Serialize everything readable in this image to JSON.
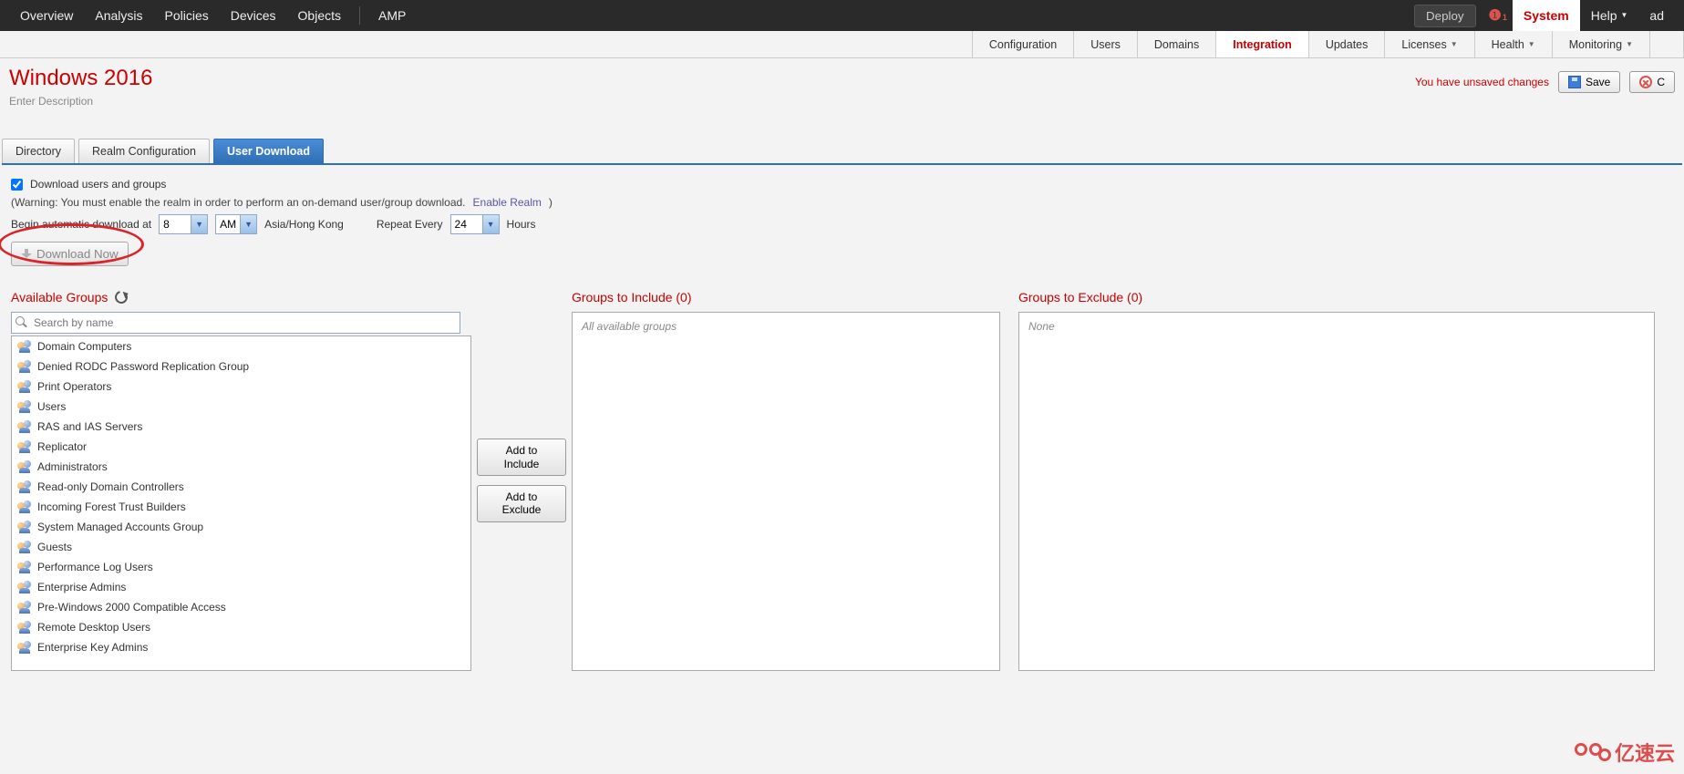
{
  "topnav": {
    "left": [
      "Overview",
      "Analysis",
      "Policies",
      "Devices",
      "Objects"
    ],
    "amp": "AMP",
    "deploy": "Deploy",
    "alert_count": "1",
    "system": "System",
    "help": "Help",
    "user_initial": "ad"
  },
  "subnav": {
    "items": [
      "Configuration",
      "Users",
      "Domains",
      "Integration",
      "Updates",
      "Licenses",
      "Health",
      "Monitoring"
    ],
    "active": "Integration",
    "dropdown_flags": [
      false,
      false,
      false,
      false,
      false,
      true,
      true,
      true
    ]
  },
  "page": {
    "title": "Windows 2016",
    "desc_placeholder": "Enter Description",
    "unsaved": "You have unsaved changes",
    "save": "Save",
    "cancel": "C"
  },
  "tabs": {
    "items": [
      "Directory",
      "Realm Configuration",
      "User Download"
    ],
    "active": "User Download"
  },
  "form": {
    "download_users_label": "Download users and groups",
    "download_users_checked": true,
    "warning_prefix": "(Warning: You must enable the realm in order to perform an on-demand user/group download. ",
    "enable_link": "Enable Realm",
    "warning_suffix": ")",
    "begin_label": "Begin automatic download at",
    "hour_value": "8",
    "ampm_value": "AM",
    "tz": "Asia/Hong Kong",
    "repeat_label": "Repeat Every",
    "repeat_value": "24",
    "hours_label": "Hours",
    "download_now": "Download Now"
  },
  "columns": {
    "available_title": "Available Groups",
    "search_placeholder": "Search by name",
    "include_title": "Groups to Include (0)",
    "include_placeholder": "All available groups",
    "exclude_title": "Groups to Exclude (0)",
    "exclude_placeholder": "None",
    "add_include": "Add to\nInclude",
    "add_exclude": "Add to\nExclude",
    "groups": [
      "Domain Computers",
      "Denied RODC Password Replication Group",
      "Print Operators",
      "Users",
      "RAS and IAS Servers",
      "Replicator",
      "Administrators",
      "Read-only Domain Controllers",
      "Incoming Forest Trust Builders",
      "System Managed Accounts Group",
      "Guests",
      "Performance Log Users",
      "Enterprise Admins",
      "Pre-Windows 2000 Compatible Access",
      "Remote Desktop Users",
      "Enterprise Key Admins"
    ]
  },
  "watermark": "亿速云"
}
